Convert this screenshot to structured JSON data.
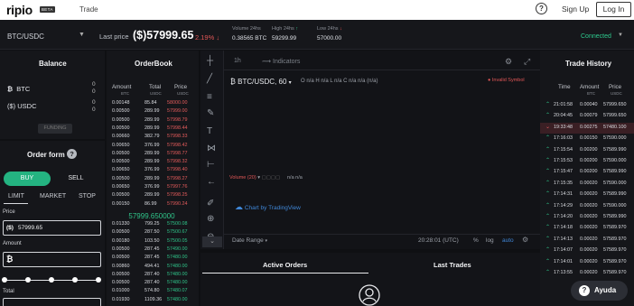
{
  "nav": {
    "logo": "ripio",
    "badge": "BETA",
    "trade": "Trade",
    "help_icon": "?",
    "sign_up": "Sign Up",
    "log_in": "Log In"
  },
  "ticker": {
    "pair": "BTC/USDC",
    "last_price_label": "Last price",
    "last_price": "57999.65",
    "change": "2.19%",
    "volume_label": "Volume 24hs",
    "volume": "0.38565 BTC",
    "high_label": "High 24hs",
    "high": "59299.99",
    "low_label": "Low 24hs",
    "low": "57000.00",
    "connected": "Connected"
  },
  "balance": {
    "title": "Balance",
    "items": [
      {
        "label": "BTC",
        "value": "0"
      },
      {
        "label": "USDC",
        "value": "0"
      }
    ],
    "funding": "FUNDING"
  },
  "order_form": {
    "title": "Order form",
    "buy": "BUY",
    "sell": "SELL",
    "tabs": [
      "LIMIT",
      "MARKET",
      "STOP"
    ],
    "price_label": "Price",
    "price_value": "57999.65",
    "amount_label": "Amount",
    "total_label": "Total"
  },
  "orderbook": {
    "title": "OrderBook",
    "headers": [
      "Amount",
      "Total",
      "Price"
    ],
    "subheaders": [
      "BTC",
      "USDC",
      "USDC"
    ],
    "asks": [
      [
        "0.00148",
        "85.84",
        "58000.00"
      ],
      [
        "0.00500",
        "289.99",
        "57999.00"
      ],
      [
        "0.00500",
        "289.99",
        "57998.79"
      ],
      [
        "0.00500",
        "289.99",
        "57998.44"
      ],
      [
        "0.00660",
        "382.79",
        "57998.33"
      ],
      [
        "0.00650",
        "376.99",
        "57998.42"
      ],
      [
        "0.00500",
        "289.99",
        "57998.77"
      ],
      [
        "0.00500",
        "289.99",
        "57998.32"
      ],
      [
        "0.00650",
        "376.99",
        "57998.40"
      ],
      [
        "0.00500",
        "289.99",
        "57998.27"
      ],
      [
        "0.00650",
        "376.99",
        "57997.76"
      ],
      [
        "0.00500",
        "289.99",
        "57998.25"
      ],
      [
        "0.00150",
        "86.99",
        "57990.24"
      ]
    ],
    "mid": "57999.650000",
    "bids": [
      [
        "0.01330",
        "799.25",
        "57500.08"
      ],
      [
        "0.00500",
        "287.50",
        "57500.67"
      ],
      [
        "0.00180",
        "103.50",
        "57500.05"
      ],
      [
        "0.00500",
        "287.45",
        "57490.00"
      ],
      [
        "0.00500",
        "287.45",
        "57480.00"
      ],
      [
        "0.00860",
        "494.41",
        "57480.00"
      ],
      [
        "0.00500",
        "287.40",
        "57480.00"
      ],
      [
        "0.00500",
        "287.40",
        "57480.00"
      ],
      [
        "0.01000",
        "574.80",
        "57480.07"
      ],
      [
        "0.01930",
        "1109.36",
        "57480.00"
      ]
    ]
  },
  "chart": {
    "interval": "1h",
    "indicators": "Indicators",
    "pair": "BTC/USDC, 60",
    "ohlc": "O n/a  H n/a  L n/a  C n/a  n/a (n/a)",
    "invalid": "Invalid Symbol",
    "volume": "Volume (20)",
    "volume_na": "n/a  n/a",
    "tv": "Chart by TradingView",
    "date_range": "Date Range",
    "time": "20:28:01 (UTC)",
    "pct": "%",
    "log": "log",
    "auto": "auto"
  },
  "orders": {
    "active": "Active Orders",
    "last": "Last Trades"
  },
  "trade_history": {
    "title": "Trade History",
    "headers": [
      "Time",
      "Amount",
      "Price"
    ],
    "subheaders": [
      "BTC",
      "USDC"
    ],
    "rows": [
      [
        "up",
        "21:01:58",
        "0.00040",
        "57999.650"
      ],
      [
        "up",
        "20:04:45",
        "0.00079",
        "57999.650"
      ],
      [
        "down",
        "19:33:48",
        "0.00275",
        "57480.100"
      ],
      [
        "up",
        "17:16:03",
        "0.00150",
        "57590.000"
      ],
      [
        "up",
        "17:15:54",
        "0.00200",
        "57589.990"
      ],
      [
        "up",
        "17:15:53",
        "0.00200",
        "57590.000"
      ],
      [
        "up",
        "17:15:47",
        "0.00200",
        "57589.990"
      ],
      [
        "up",
        "17:15:35",
        "0.00020",
        "57590.000"
      ],
      [
        "up",
        "17:14:31",
        "0.00020",
        "57589.990"
      ],
      [
        "up",
        "17:14:29",
        "0.00020",
        "57590.000"
      ],
      [
        "up",
        "17:14:20",
        "0.00020",
        "57589.990"
      ],
      [
        "up",
        "17:14:18",
        "0.00020",
        "57589.970"
      ],
      [
        "up",
        "17:14:13",
        "0.00020",
        "57589.970"
      ],
      [
        "up",
        "17:14:07",
        "0.00020",
        "57589.970"
      ],
      [
        "up",
        "17:14:01",
        "0.00020",
        "57589.970"
      ],
      [
        "up",
        "17:13:55",
        "0.00020",
        "57589.970"
      ]
    ]
  },
  "help_button": {
    "icon": "?",
    "label": "Ayuda"
  }
}
